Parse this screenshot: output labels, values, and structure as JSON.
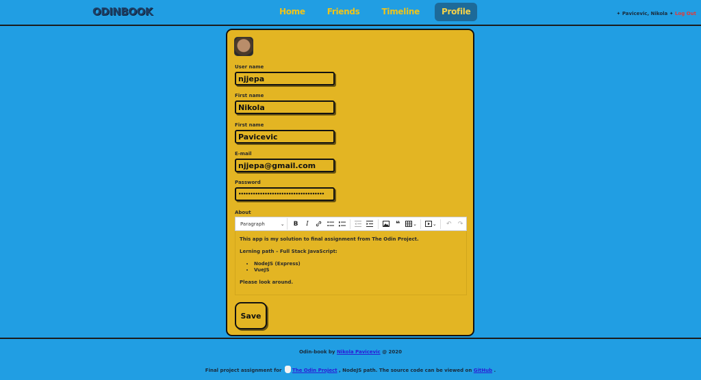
{
  "header": {
    "logo": "ODINBOOK",
    "nav": [
      {
        "label": "Home"
      },
      {
        "label": "Friends"
      },
      {
        "label": "Timeline"
      },
      {
        "label": "Profile",
        "active": true
      }
    ],
    "user_name": "Pavicevic, Nikola",
    "logout": "Log Out"
  },
  "form": {
    "username_label": "User name",
    "username": "njjepa",
    "firstname_label": "First name",
    "firstname": "Nikola",
    "lastname_label": "First name",
    "lastname": "Pavicevic",
    "email_label": "E-mail",
    "email": "njjepa@gmail.com",
    "password_label": "Password",
    "password": "••••••••••••••••••••••••••••••••••••",
    "about_label": "About",
    "editor": {
      "paragraph_select": "Paragraph",
      "p1": "This app is my solution to final assignment from The Odin Project.",
      "p2": "Lerning path – Full Stack JavaScript:",
      "list": [
        "NodeJS (Express)",
        "VueJS"
      ],
      "p3": "Please look around."
    },
    "save_label": "Save"
  },
  "footer": {
    "line1_prefix": "Odin-book by ",
    "author": "Nikola Pavicevic",
    "line1_suffix": " @ 2020",
    "line2_prefix": "Final project assignment for ",
    "odin_link": "The Odin Project",
    "line2_mid": " , NodeJS path. The source code can be viewed on ",
    "github_link": "GitHub",
    "line2_suffix": " ."
  },
  "colors": {
    "background": "#219ee3",
    "card": "#e3b523",
    "nav_text": "#f0c419",
    "logout": "#e53935"
  }
}
